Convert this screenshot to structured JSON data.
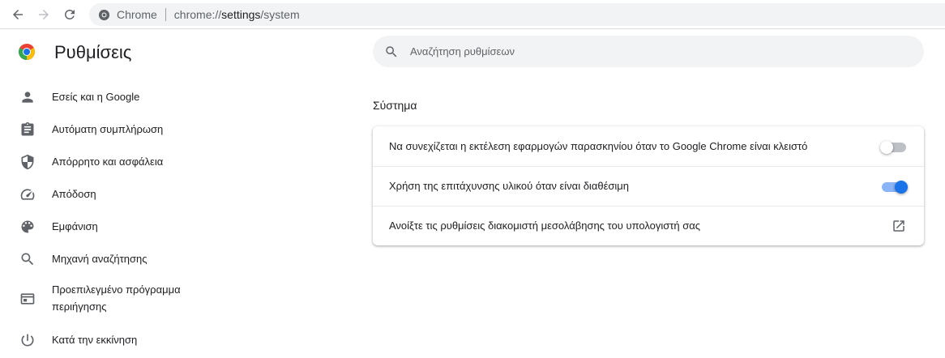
{
  "browser": {
    "site_label": "Chrome",
    "url_scheme": "chrome://",
    "url_host": "settings",
    "url_path": "/system",
    "icons": {
      "back": "arrow-left-icon",
      "forward": "arrow-right-icon",
      "reload": "reload-icon",
      "site": "chrome-page-icon"
    }
  },
  "header": {
    "title": "Ρυθμίσεις",
    "logo_icon": "chrome-logo-icon"
  },
  "search": {
    "placeholder": "Αναζήτηση ρυθμίσεων",
    "value": "",
    "icon": "search-icon"
  },
  "sidebar": {
    "items": [
      {
        "label": "Εσείς και η Google",
        "icon": "person-icon"
      },
      {
        "label": "Αυτόματη συμπλήρωση",
        "icon": "clipboard-icon"
      },
      {
        "label": "Απόρρητο και ασφάλεια",
        "icon": "shield-icon"
      },
      {
        "label": "Απόδοση",
        "icon": "speedometer-icon"
      },
      {
        "label": "Εμφάνιση",
        "icon": "palette-icon"
      },
      {
        "label": "Μηχανή αναζήτησης",
        "icon": "search-icon"
      },
      {
        "label_line1": "Προεπιλεγμένο πρόγραμμα",
        "label_line2": "περιήγησης",
        "icon": "browser-window-icon"
      },
      {
        "label": "Κατά την εκκίνηση",
        "icon": "power-icon"
      }
    ]
  },
  "main": {
    "section_title": "Σύστημα",
    "rows": [
      {
        "label": "Να συνεχίζεται η εκτέλεση εφαρμογών παρασκηνίου όταν το Google Chrome είναι κλειστό",
        "control": "toggle",
        "checked": false
      },
      {
        "label": "Χρήση της επιτάχυνσης υλικού όταν είναι διαθέσιμη",
        "control": "toggle",
        "checked": true
      },
      {
        "label": "Ανοίξτε τις ρυθμίσεις διακομιστή μεσολάβησης του υπολογιστή σας",
        "control": "external-link",
        "icon": "open-in-new-icon"
      }
    ]
  },
  "colors": {
    "accent": "#1a73e8",
    "accent_light": "#8ab4f8",
    "toggle_off": "#bdc1c6",
    "icon_grey": "#5f6368",
    "text": "#202124"
  }
}
